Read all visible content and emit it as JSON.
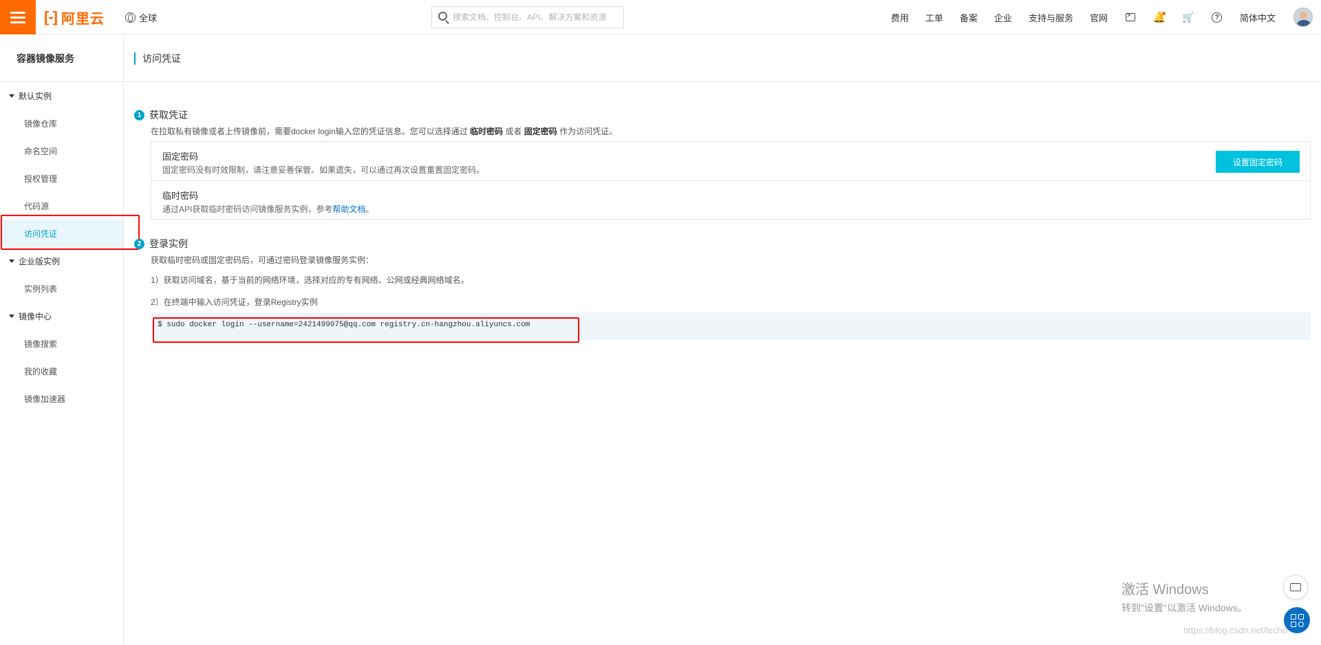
{
  "topbar": {
    "logo_text": "阿里云",
    "region": "全球",
    "search_placeholder": "搜索文档、控制台、API、解决方案和资源",
    "nav": [
      "费用",
      "工单",
      "备案",
      "企业",
      "支持与服务",
      "官网"
    ],
    "lang": "简体中文"
  },
  "sidebar": {
    "title": "容器镜像服务",
    "groups": [
      {
        "label": "默认实例",
        "items": [
          "镜像仓库",
          "命名空间",
          "授权管理",
          "代码源",
          "访问凭证"
        ]
      },
      {
        "label": "企业版实例",
        "items": [
          "实例列表"
        ]
      },
      {
        "label": "镜像中心",
        "items": [
          "镜像搜索",
          "我的收藏",
          "镜像加速器"
        ]
      }
    ],
    "active_item": "访问凭证"
  },
  "page": {
    "title": "访问凭证",
    "step1": {
      "num": "1",
      "title": "获取凭证",
      "desc_a": "在拉取私有镜像或者上传镜像前，需要docker login输入您的凭证信息。您可以选择通过 ",
      "desc_b1": "临时密码",
      "desc_or": " 或者 ",
      "desc_b2": "固定密码",
      "desc_c": " 作为访问凭证。",
      "fixed_name": "固定密码",
      "fixed_desc": "固定密码没有时效限制，请注意妥善保管。如果遗失，可以通过再次设置重置固定密码。",
      "fixed_button": "设置固定密码",
      "temp_name": "临时密码",
      "temp_desc": "通过API获取临时密码访问镜像服务实例，参考",
      "temp_link": "帮助文档",
      "temp_end": "。"
    },
    "step2": {
      "num": "2",
      "title": "登录实例",
      "desc": "获取临时密码或固定密码后，可通过密码登录镜像服务实例：",
      "line1": "1）获取访问域名，基于当前的网络环境，选择对应的专有网络、公网或经典网络域名。",
      "line2": "2）在终端中输入访问凭证，登录Registry实例",
      "code": "$ sudo docker login --username=2421499075@qq.com registry.cn-hangzhou.aliyuncs.com"
    }
  },
  "overlay": {
    "watermark_1": "激活 Windows",
    "watermark_2": "转到\"设置\"以激活 Windows。",
    "csdn": "https://blog.csdn.net/lecho"
  },
  "colors": {
    "brand": "#ff6a00",
    "accent": "#00a2ca",
    "button": "#00c1de",
    "highlight": "#ff0000"
  }
}
